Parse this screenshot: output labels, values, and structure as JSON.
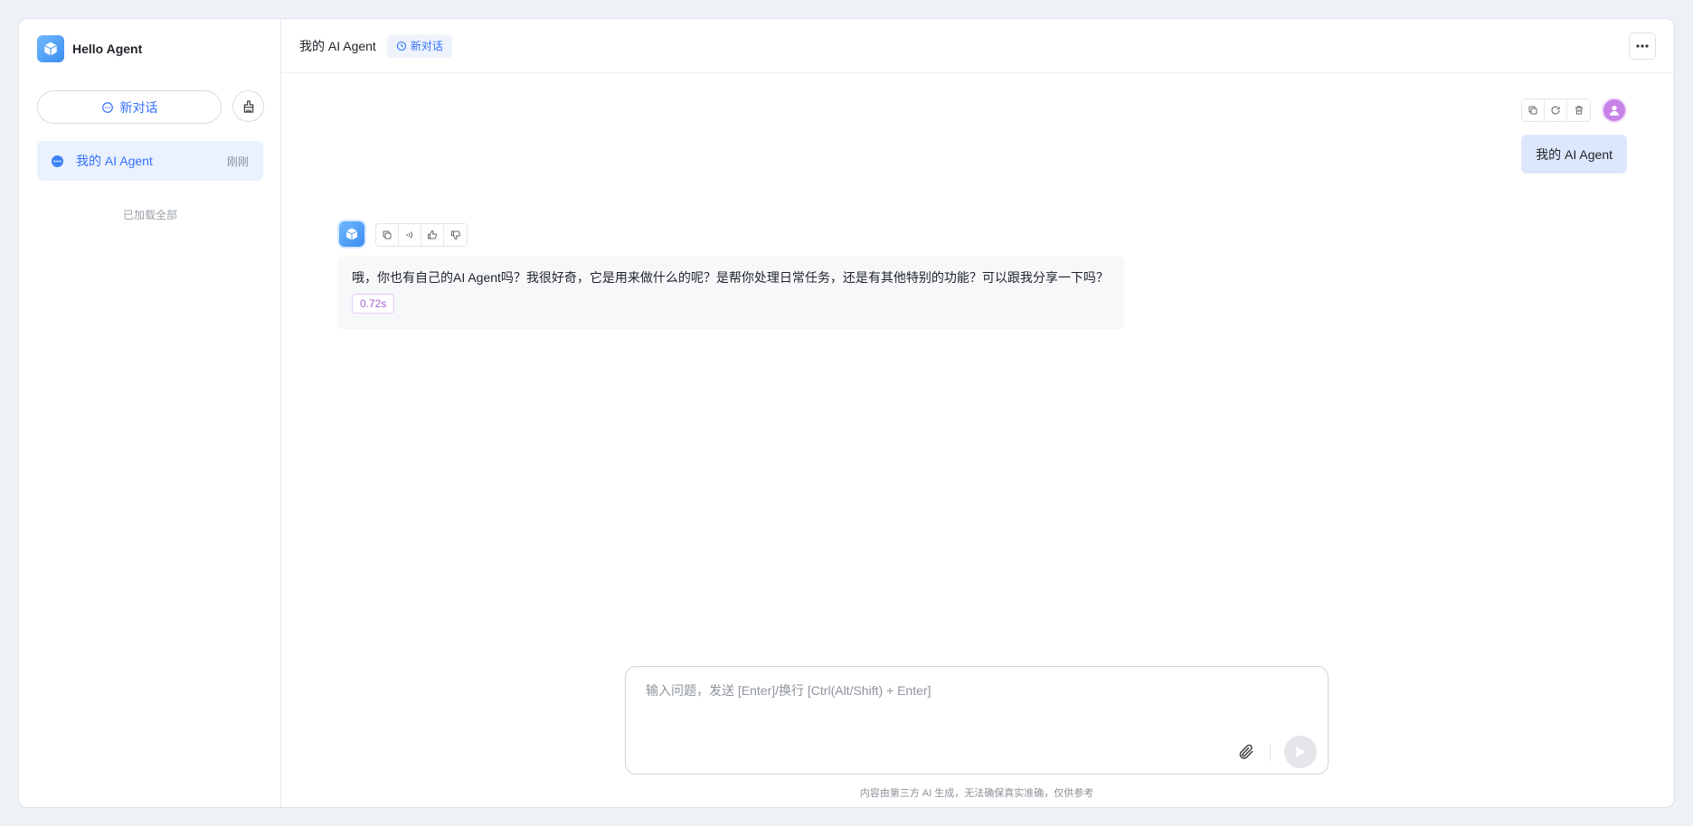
{
  "app": {
    "brand": "Hello Agent"
  },
  "sidebar": {
    "new_chat_label": "新对话",
    "clean_icon": "broom-icon",
    "conversations": [
      {
        "title": "我的 AI Agent",
        "time": "刚刚",
        "active": true
      }
    ],
    "loaded_all": "已加载全部"
  },
  "header": {
    "title": "我的 AI Agent",
    "tag": "新对话",
    "more_icon": "ellipsis-icon"
  },
  "messages": {
    "user": {
      "text": "我的 AI Agent",
      "actions": [
        "copy-icon",
        "refresh-icon",
        "delete-icon"
      ]
    },
    "bot": {
      "text": "哦，你也有自己的AI Agent吗？我很好奇，它是用来做什么的呢？是帮你处理日常任务，还是有其他特别的功能？可以跟我分享一下吗？",
      "time": "0.72s",
      "actions": [
        "copy-icon",
        "speaker-icon",
        "thumbs-up-icon",
        "thumbs-down-icon"
      ]
    }
  },
  "composer": {
    "placeholder": "输入问题，发送 [Enter]/换行 [Ctrl(Alt/Shift) + Enter]",
    "value": ""
  },
  "footer": {
    "disclaimer": "内容由第三方 AI 生成，无法确保真实准确，仅供参考"
  },
  "colors": {
    "accent": "#3370ff",
    "bot_avatar": "#3b8cf0",
    "user_avatar": "#c882e8",
    "user_bubble": "#dde7fb",
    "time_badge": "#a35fd1"
  }
}
